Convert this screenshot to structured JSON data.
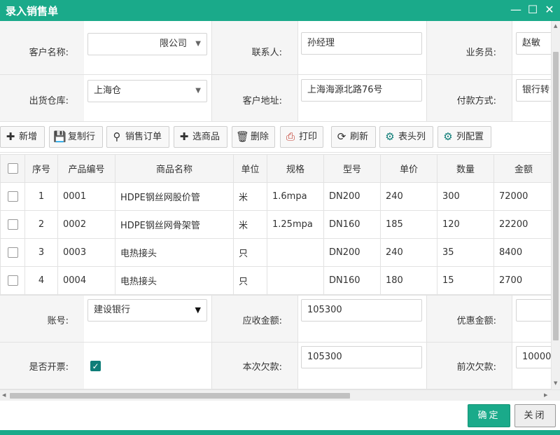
{
  "window": {
    "title": "录入销售单"
  },
  "form_top": {
    "customer_label": "客户名称:",
    "customer_value": "限公司",
    "contact_label": "联系人:",
    "contact_value": "孙经理",
    "salesperson_label": "业务员:",
    "salesperson_value": "赵敏",
    "warehouse_label": "出货仓库:",
    "warehouse_value": "上海仓",
    "address_label": "客户地址:",
    "address_value": "上海海源北路76号",
    "payment_label": "付款方式:",
    "payment_value": "银行转!"
  },
  "toolbar": {
    "add": "新增",
    "copy_row": "复制行",
    "sales_order": "销售订单",
    "select_product": "选商品",
    "delete": "删除",
    "print": "打印",
    "refresh": "刷新",
    "header_cols": "表头列",
    "column_config": "列配置"
  },
  "table": {
    "headers": [
      "序号",
      "产品编号",
      "商品名称",
      "单位",
      "规格",
      "型号",
      "单价",
      "数量",
      "金额"
    ],
    "rows": [
      [
        "1",
        "0001",
        "HDPE钢丝网股价管",
        "米",
        "1.6mpa",
        "DN200",
        "240",
        "300",
        "72000"
      ],
      [
        "2",
        "0002",
        "HDPE钢丝网骨架管",
        "米",
        "1.25mpa",
        "DN160",
        "185",
        "120",
        "22200"
      ],
      [
        "3",
        "0003",
        "电热接头",
        "只",
        "",
        "DN200",
        "240",
        "35",
        "8400"
      ],
      [
        "4",
        "0004",
        "电热接头",
        "只",
        "",
        "DN160",
        "180",
        "15",
        "2700"
      ]
    ]
  },
  "form_bottom": {
    "account_label": "账号:",
    "account_value": "建设银行",
    "receivable_label": "应收金额:",
    "receivable_value": "105300",
    "discount_label": "优惠金额:",
    "discount_value": "",
    "invoice_label": "是否开票:",
    "invoice_checked": true,
    "current_debt_label": "本次欠款:",
    "current_debt_value": "105300",
    "prev_debt_label": "前次欠款:",
    "prev_debt_value": "10000"
  },
  "footer": {
    "ok": "确定",
    "close": "关闭"
  },
  "colors": {
    "accent": "#1aaa8a",
    "checkbox": "#0f7d78"
  }
}
